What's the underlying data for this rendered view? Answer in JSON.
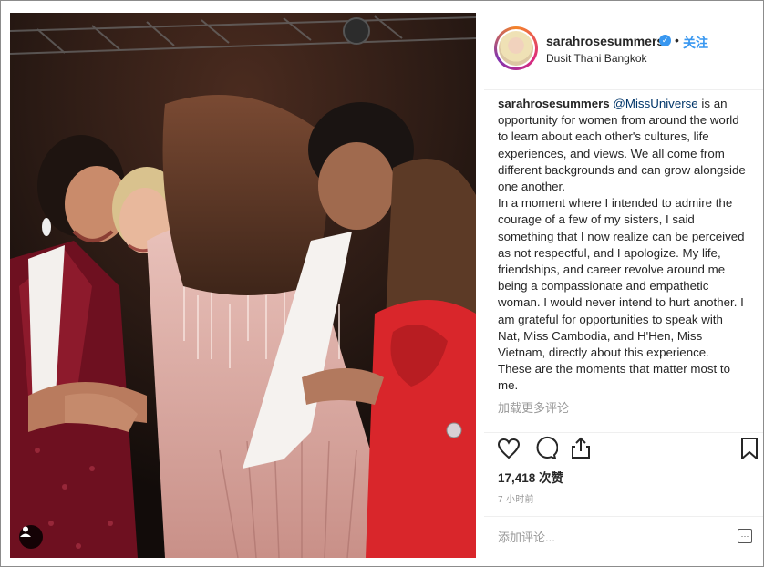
{
  "post": {
    "username": "sarahrosesummers",
    "follow_label": "关注",
    "separator": "•",
    "location": "Dusit Thani Bangkok"
  },
  "caption": {
    "username": "sarahrosesummers",
    "mention": "@MissUniverse",
    "text": " is an opportunity for women from around the world to learn about each other's cultures, life experiences, and views. We all come from different backgrounds and can grow alongside one another.\nIn a moment where I intended to admire the courage of a few of my sisters, I said something that I now realize can be perceived as not respectful, and I apologize. My life, friendships, and career revolve around me being a compassionate and empathetic woman. I would never intend to hurt another. I am grateful for opportunities to speak with Nat, Miss Cambodia, and H'Hen, Miss Vietnam, directly about this experience. These are the moments that matter most to me."
  },
  "load_more_label": "加载更多评论",
  "likes": "17,418 次赞",
  "time_ago": "7 小时前",
  "comment_input": {
    "placeholder": "添加评论..."
  },
  "icons": {
    "like": "heart-icon",
    "comment": "comment-icon",
    "share": "share-icon",
    "save": "bookmark-icon",
    "verified": "verified-badge-icon",
    "user_tag": "person-icon",
    "more": "more-options-icon"
  },
  "colors": {
    "link": "#3897f0",
    "mention": "#003569",
    "secondary_text": "#999999",
    "primary_text": "#262626"
  }
}
